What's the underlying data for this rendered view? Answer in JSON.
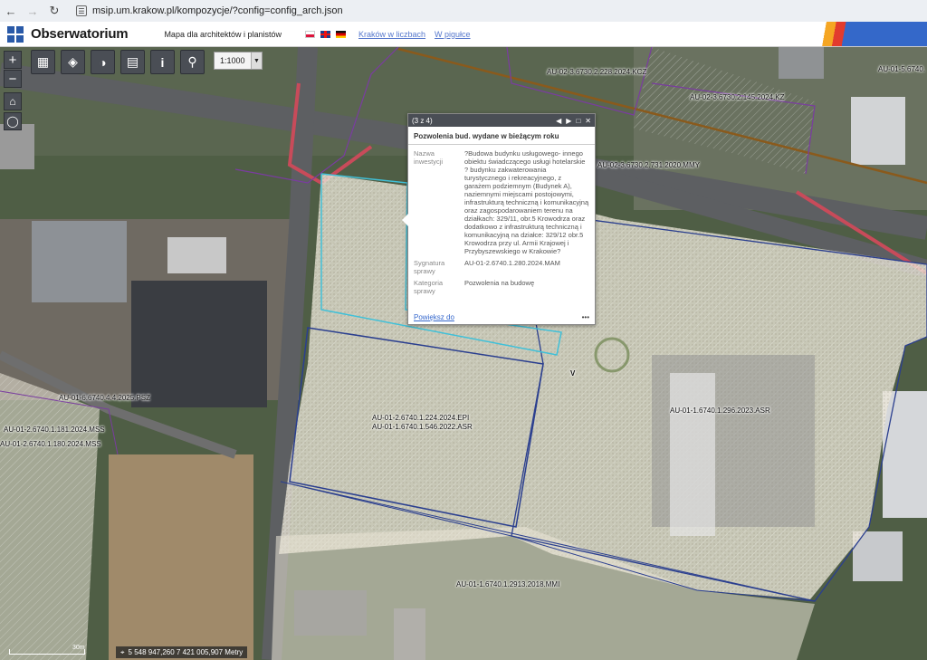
{
  "browser": {
    "url": "msip.um.krakow.pl/kompozycje/?config=config_arch.json"
  },
  "header": {
    "title": "Obserwatorium",
    "subtitle": "Mapa dla architektów i planistów",
    "links": [
      "Kraków w liczbach",
      "W pigułce"
    ]
  },
  "toolbar": {
    "scale": "1:1000",
    "icons": [
      "grid-icon",
      "layers-icon",
      "binoculars-icon",
      "map-icon",
      "info-icon",
      "search-icon"
    ]
  },
  "parcels": [
    "AU-02-3.6730.2.228.2024.KCZ",
    "AU-02-3.6730.2.145.2024.KZ",
    "AU-01-5.6740.",
    "AU-02-3.6730.2.731.2020.MMY",
    "AU-01-6.6740.4.4.2025.PSZ",
    "AU-01-2.6740.1.181.2024.MSS",
    "AU-01-2.6740.1.180.2024.MSS",
    "AU-01-2.6740.1.224.2024.EPI",
    "AU-01-1.6740.1.546.2022.ASR",
    "AU-01-1.6740.1.296.2023.ASR",
    "AU-01-1.6740.1.2913.2018.MMI"
  ],
  "popup": {
    "pager": "(3 z 4)",
    "title": "Pozwolenia bud. wydane w bieżącym roku",
    "rows": [
      {
        "key": "Nazwa inwestycji",
        "value": "?Budowa budynku usługowego- innego obiektu świadczącego usługi hotelarskie ? budynku zakwaterowania turystycznego i rekreacyjnego, z garażem podziemnym (Budynek A), naziemnymi miejscami postojowymi, infrastrukturą techniczną i komunikacyjną oraz zagospodarowaniem terenu na działkach: 329/11, obr.5 Krowodrza oraz dodatkowo z infrastrukturą techniczną i komunikacyjną na działce: 329/12 obr.5 Krowodrza przy ul. Armii Krajowej i Przybyszewskiego w Krakowie?"
      },
      {
        "key": "Sygnatura sprawy",
        "value": "AU-01-2.6740.1.280.2024.MAM"
      },
      {
        "key": "Kategoria sprawy",
        "value": "Pozwolenia na budowę"
      }
    ],
    "zoom_link": "Powiększ do",
    "more": "•••"
  },
  "footer": {
    "coords": "5 548 947,260 7 421 005,907 Metry",
    "scale_label": "30m"
  },
  "map_marker": "V"
}
